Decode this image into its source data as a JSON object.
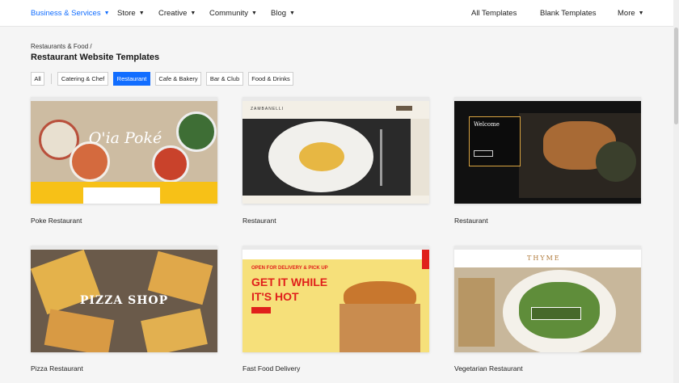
{
  "nav": {
    "items": [
      {
        "label": "Business & Services",
        "active": true
      },
      {
        "label": "Store"
      },
      {
        "label": "Creative"
      },
      {
        "label": "Community"
      },
      {
        "label": "Blog"
      }
    ],
    "right": {
      "all_templates": "All Templates",
      "blank_templates": "Blank Templates",
      "more": "More"
    }
  },
  "breadcrumb": "Restaurants & Food /",
  "page_title": "Restaurant Website Templates",
  "filters": [
    {
      "label": "All"
    },
    {
      "label": "Catering & Chef"
    },
    {
      "label": "Restaurant",
      "active": true
    },
    {
      "label": "Cafe & Bakery"
    },
    {
      "label": "Bar & Club"
    },
    {
      "label": "Food & Drinks"
    }
  ],
  "templates": [
    {
      "name": "Poke Restaurant",
      "overlay": "O'ia Poké",
      "accent": "#f7c117"
    },
    {
      "name": "Restaurant",
      "brand": "ZAMBANELLI"
    },
    {
      "name": "Restaurant",
      "heading": "Welcome",
      "accent": "#d9a441"
    },
    {
      "name": "Pizza Restaurant",
      "headline": "PIZZA SHOP"
    },
    {
      "name": "Fast Food Delivery",
      "eyebrow": "OPEN FOR DELIVERY & PICK UP",
      "headline_1": "GET IT WHILE",
      "headline_2": "IT'S HOT",
      "accent": "#e0201b",
      "bg": "#f6e07a"
    },
    {
      "name": "Vegetarian Restaurant",
      "brand": "THYME"
    }
  ],
  "colors": {
    "accent": "#116dff",
    "page_bg": "#f5f5f5"
  }
}
